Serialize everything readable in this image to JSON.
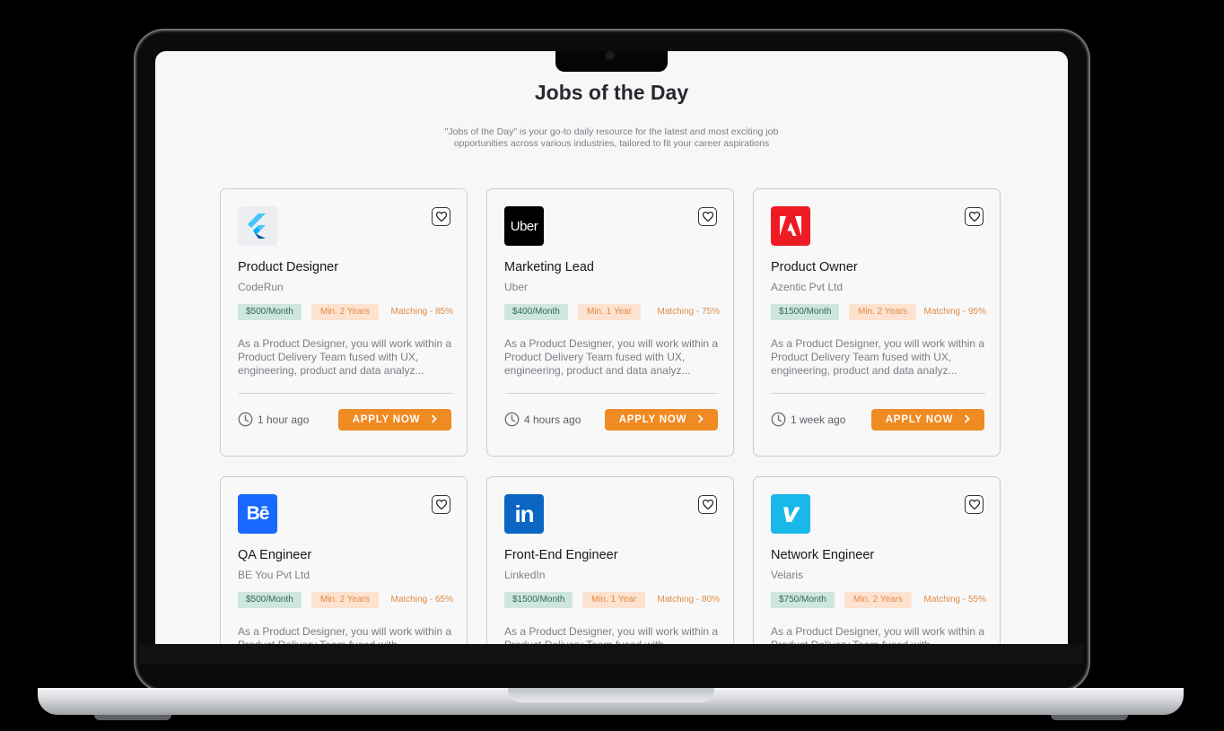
{
  "page": {
    "title": "Jobs of the Day",
    "subtitle": "\"Jobs of the Day\" is your go-to daily resource for the latest and most exciting job opportunities across various industries, tailored to fit your career aspirations"
  },
  "colors": {
    "accent": "#f08a22",
    "salary_tag_bg": "#cfe6dd",
    "experience_tag_bg": "#fde2cf"
  },
  "jobs": [
    {
      "title": "Product Designer",
      "company": "CodeRun",
      "salary": "$500/Month",
      "experience": "Min. 2 Years",
      "matching": "Matching - 85%",
      "description": "As a Product Designer, you will work within a Product Delivery Team fused with UX, engineering, product and data analyz...",
      "posted": "1 hour ago",
      "apply_label": "APPLY NOW",
      "logo": "flutter-logo"
    },
    {
      "title": "Marketing Lead",
      "company": "Uber",
      "salary": "$400/Month",
      "experience": "Min. 1 Year",
      "matching": "Matching - 75%",
      "description": "As a Product Designer, you will work within a Product Delivery Team fused with UX, engineering, product and data analyz...",
      "posted": "4 hours ago",
      "apply_label": "APPLY NOW",
      "logo": "uber-logo",
      "logo_text": "Uber"
    },
    {
      "title": "Product Owner",
      "company": "Azentic Pvt Ltd",
      "salary": "$1500/Month",
      "experience": "Min. 2 Years",
      "matching": "Matching - 95%",
      "description": "As a Product Designer, you will work within a Product Delivery Team fused with UX, engineering, product and data analyz...",
      "posted": "1 week ago",
      "apply_label": "APPLY NOW",
      "logo": "adobe-logo"
    },
    {
      "title": "QA Engineer",
      "company": "BE You Pvt Ltd",
      "salary": "$500/Month",
      "experience": "Min. 2 Years",
      "matching": "Matching - 65%",
      "description": "As a Product Designer, you will work within a Product Delivery Team fused with",
      "logo": "behance-logo",
      "logo_text": "Bē"
    },
    {
      "title": "Front-End Engineer",
      "company": "LinkedIn",
      "salary": "$1500/Month",
      "experience": "Min. 1 Year",
      "matching": "Matching - 80%",
      "description": "As a Product Designer, you will work within a Product Delivery Team fused with",
      "logo": "linkedin-logo",
      "logo_text": "in"
    },
    {
      "title": "Network Engineer",
      "company": "Velaris",
      "salary": "$750/Month",
      "experience": "Min. 2 Years",
      "matching": "Matching - 55%",
      "description": "As a Product Designer, you will work within a Product Delivery Team fused with",
      "logo": "vimeo-logo",
      "logo_text": "v"
    }
  ]
}
